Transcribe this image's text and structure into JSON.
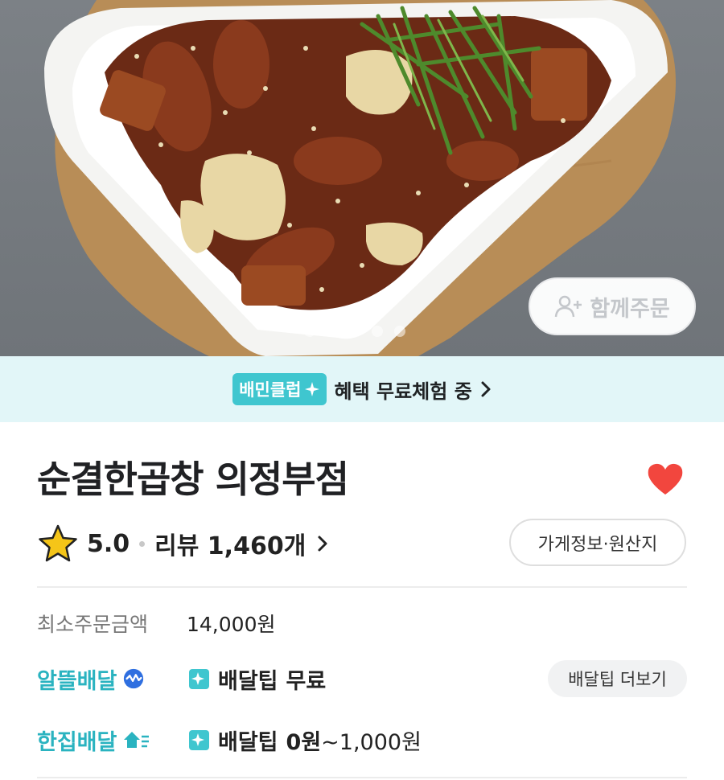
{
  "hero": {
    "group_order_label": "함께주문",
    "carousel": {
      "total": 5,
      "active_index": 2
    }
  },
  "club_banner": {
    "badge": "배민클럽",
    "text": "혜택 무료체험 중"
  },
  "store": {
    "name": "순결한곱창 의정부점",
    "favorited": true,
    "rating": "5.0",
    "review_label": "리뷰 1,460개",
    "info_button": "가게정보·원산지"
  },
  "order": {
    "min_order_label": "최소주문금액",
    "min_order_value": "14,000원"
  },
  "delivery": {
    "saver": {
      "type_label": "알뜰배달",
      "tip_label": "배달팁",
      "tip_value": "무료"
    },
    "single": {
      "type_label": "한집배달",
      "tip_label": "배달팁",
      "tip_value": "0원",
      "tip_range": "~1,000원"
    },
    "more_button": "배달팁 더보기"
  },
  "colors": {
    "accent_mint": "#2ab3c0",
    "club_badge": "#3fc6cf",
    "banner_bg": "#e2f6f8",
    "heart": "#f2463e",
    "star": "#f5c518"
  }
}
